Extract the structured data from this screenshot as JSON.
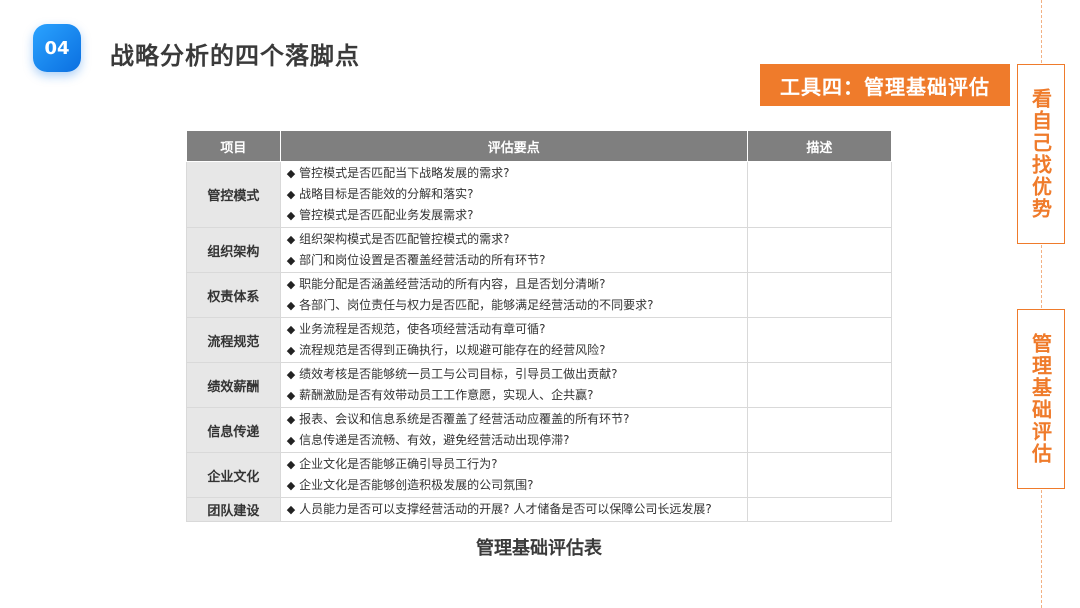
{
  "header": {
    "badge": "04",
    "title": "战略分析的四个落脚点"
  },
  "tool_banner": "工具四：管理基础评估",
  "side": {
    "box1": "看自己找优势",
    "box2": "管理基础评估"
  },
  "table": {
    "headers": [
      "项目",
      "评估要点",
      "描述"
    ],
    "rows": [
      {
        "category": "管控模式",
        "points": [
          "管控模式是否匹配当下战略发展的需求?",
          "战略目标是否能效的分解和落实?",
          "管控模式是否匹配业务发展需求?"
        ]
      },
      {
        "category": "组织架构",
        "points": [
          "组织架构模式是否匹配管控模式的需求?",
          "部门和岗位设置是否覆盖经营活动的所有环节?"
        ]
      },
      {
        "category": "权责体系",
        "points": [
          "职能分配是否涵盖经营活动的所有内容，且是否划分清晰?",
          "各部门、岗位责任与权力是否匹配，能够满足经营活动的不同要求?"
        ]
      },
      {
        "category": "流程规范",
        "points": [
          "业务流程是否规范，使各项经营活动有章可循?",
          "流程规范是否得到正确执行，以规避可能存在的经营风险?"
        ]
      },
      {
        "category": "绩效薪酬",
        "points": [
          "绩效考核是否能够统一员工与公司目标，引导员工做出贡献?",
          "薪酬激励是否有效带动员工工作意愿，实现人、企共赢?"
        ]
      },
      {
        "category": "信息传递",
        "points": [
          "报表、会议和信息系统是否覆盖了经营活动应覆盖的所有环节?",
          "信息传递是否流畅、有效，避免经营活动出现停滞?"
        ]
      },
      {
        "category": "企业文化",
        "points": [
          "企业文化是否能够正确引导员工行为?",
          "企业文化是否能够创造积极发展的公司氛围?"
        ]
      },
      {
        "category": "团队建设",
        "points": [
          "人员能力是否可以支撑经营活动的开展? 人才储备是否可以保障公司长远发展?"
        ]
      }
    ]
  },
  "bullet_icon": "◆",
  "caption": "管理基础评估表"
}
